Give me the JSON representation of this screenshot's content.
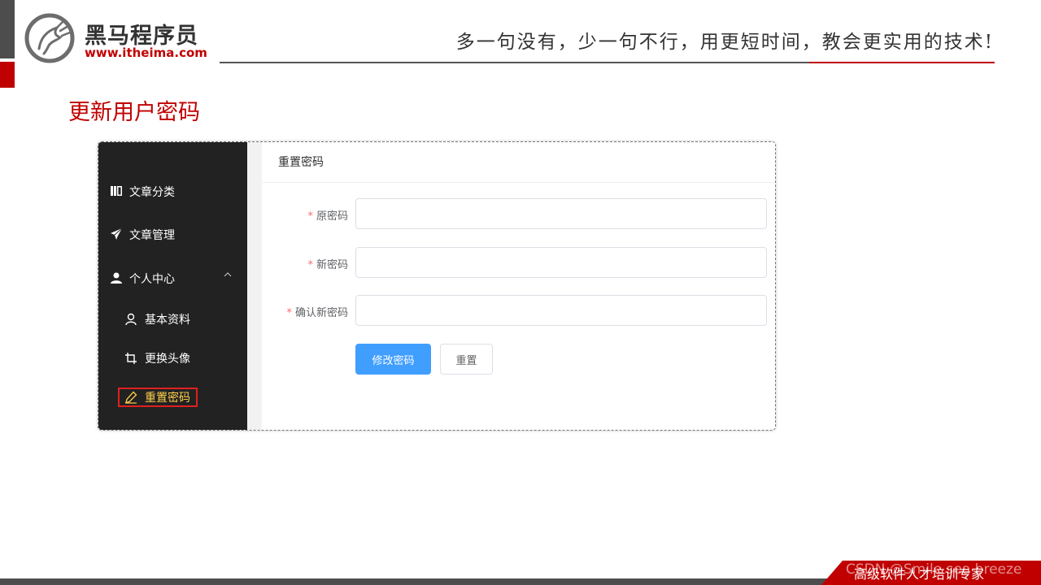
{
  "header": {
    "logo_cn": "黑马程序员",
    "logo_url": "www.itheima.com",
    "slogan": "多一句没有，少一句不行，用更短时间，教会更实用的技术!"
  },
  "slide_title": "更新用户密码",
  "sidebar": {
    "items": [
      {
        "label": "文章分类",
        "icon": "book-icon"
      },
      {
        "label": "文章管理",
        "icon": "send-icon"
      },
      {
        "label": "个人中心",
        "icon": "user-icon",
        "expanded": true
      }
    ],
    "sub_items": [
      {
        "label": "基本资料",
        "icon": "user-outline-icon"
      },
      {
        "label": "更换头像",
        "icon": "crop-icon"
      },
      {
        "label": "重置密码",
        "icon": "edit-icon",
        "active": true
      }
    ],
    "colors": {
      "background": "#222222",
      "active_text": "#ffd04b",
      "highlight_box": "#e0201f"
    }
  },
  "card": {
    "title": "重置密码",
    "form": {
      "required_mark": "*",
      "fields": [
        {
          "label": "原密码",
          "value": ""
        },
        {
          "label": "新密码",
          "value": ""
        },
        {
          "label": "确认新密码",
          "value": ""
        }
      ],
      "submit_label": "修改密码",
      "reset_label": "重置"
    },
    "colors": {
      "primary": "#409eff",
      "required": "#f56c6c"
    }
  },
  "footer": {
    "text": "高级软件人才培训专家",
    "watermark": "CSDN @Smile sea breeze"
  },
  "colors": {
    "brand_red": "#c00000"
  }
}
